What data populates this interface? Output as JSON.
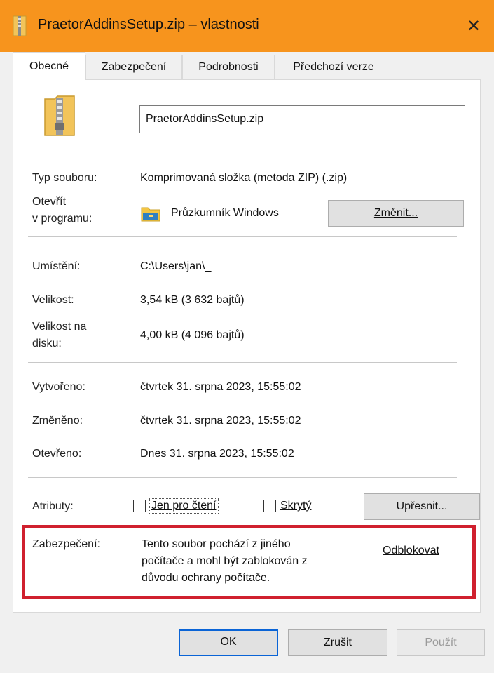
{
  "window": {
    "title": "PraetorAddinsSetup.zip – vlastnosti",
    "close_glyph": "✕"
  },
  "tabs": [
    {
      "label": "Obecné",
      "active": true
    },
    {
      "label": "Zabezpečení",
      "active": false
    },
    {
      "label": "Podrobnosti",
      "active": false
    },
    {
      "label": "Předchozí verze",
      "active": false
    }
  ],
  "general": {
    "file_name": "PraetorAddinsSetup.zip",
    "type_label": "Typ souboru:",
    "type_value": "Komprimovaná složka (metoda ZIP) (.zip)",
    "open_with_label_1": "Otevřít",
    "open_with_label_2": "v programu:",
    "open_with_value": "Průzkumník Windows",
    "change_button": "Změnit...",
    "location_label": "Umístění:",
    "location_value": "C:\\Users\\jan\\_",
    "size_label": "Velikost:",
    "size_value": "3,54 kB (3 632 bajtů)",
    "disk_size_label_1": "Velikost na",
    "disk_size_label_2": "disku:",
    "disk_size_value": "4,00 kB (4 096 bajtů)",
    "created_label": "Vytvořeno:",
    "created_value": "čtvrtek 31. srpna 2023, 15:55:02",
    "modified_label": "Změněno:",
    "modified_value": "čtvrtek 31. srpna 2023, 15:55:02",
    "accessed_label": "Otevřeno:",
    "accessed_value": "Dnes 31. srpna 2023, 15:55:02",
    "attributes_label": "Atributy:",
    "readonly_label": "Jen pro čtení",
    "readonly_checked": false,
    "hidden_label": "Skrytý",
    "hidden_checked": false,
    "advanced_button": "Upřesnit...",
    "security_label": "Zabezpečení:",
    "security_text_1": "Tento soubor pochází z jiného",
    "security_text_2": "počítače a mohl být zablokován z",
    "security_text_3": "důvodu ochrany počítače.",
    "unblock_label": "Odblokovat",
    "unblock_checked": false
  },
  "footer": {
    "ok_button": "OK",
    "cancel_button": "Zrušit",
    "apply_button": "Použít"
  },
  "icons": {
    "title": "zip-folder-icon",
    "file": "zip-folder-large-icon",
    "program": "file-explorer-icon",
    "close": "close-icon"
  },
  "colors": {
    "titlebar": "#f7941d",
    "highlight_frame": "#d0202e",
    "default_button_border": "#0a64d6"
  }
}
